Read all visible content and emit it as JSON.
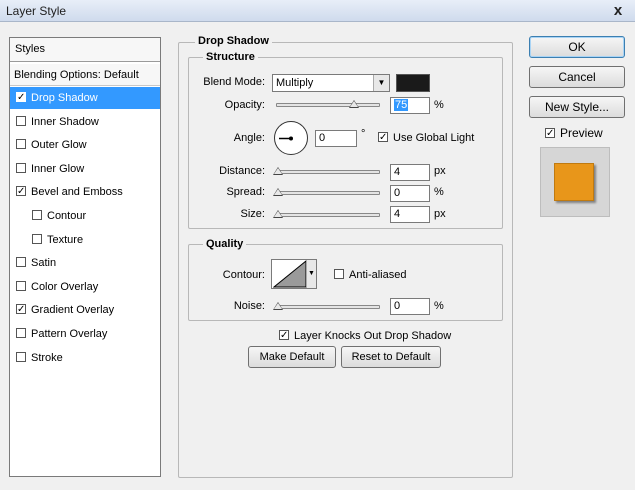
{
  "window": {
    "title": "Layer Style",
    "close_glyph": "x"
  },
  "styles_panel": {
    "header": "Styles",
    "blending": "Blending Options: Default",
    "items": [
      {
        "label": "Drop Shadow",
        "checked": true,
        "selected": true,
        "sub": false
      },
      {
        "label": "Inner Shadow",
        "checked": false,
        "selected": false,
        "sub": false
      },
      {
        "label": "Outer Glow",
        "checked": false,
        "selected": false,
        "sub": false
      },
      {
        "label": "Inner Glow",
        "checked": false,
        "selected": false,
        "sub": false
      },
      {
        "label": "Bevel and Emboss",
        "checked": true,
        "selected": false,
        "sub": false
      },
      {
        "label": "Contour",
        "checked": false,
        "selected": false,
        "sub": true
      },
      {
        "label": "Texture",
        "checked": false,
        "selected": false,
        "sub": true
      },
      {
        "label": "Satin",
        "checked": false,
        "selected": false,
        "sub": false
      },
      {
        "label": "Color Overlay",
        "checked": false,
        "selected": false,
        "sub": false
      },
      {
        "label": "Gradient Overlay",
        "checked": true,
        "selected": false,
        "sub": false
      },
      {
        "label": "Pattern Overlay",
        "checked": false,
        "selected": false,
        "sub": false
      },
      {
        "label": "Stroke",
        "checked": false,
        "selected": false,
        "sub": false
      }
    ]
  },
  "drop_shadow": {
    "title": "Drop Shadow",
    "structure": {
      "title": "Structure",
      "blend_mode_label": "Blend Mode:",
      "blend_mode_value": "Multiply",
      "shadow_color": "#1a1a1a",
      "opacity_label": "Opacity:",
      "opacity_value": "75",
      "opacity_unit": "%",
      "opacity_fraction": 0.75,
      "angle_label": "Angle:",
      "angle_value": "0",
      "angle_unit": "°",
      "use_global_light_label": "Use Global Light",
      "use_global_light": true,
      "distance_label": "Distance:",
      "distance_value": "4",
      "distance_unit": "px",
      "spread_label": "Spread:",
      "spread_value": "0",
      "spread_unit": "%",
      "size_label": "Size:",
      "size_value": "4",
      "size_unit": "px"
    },
    "quality": {
      "title": "Quality",
      "contour_label": "Contour:",
      "anti_aliased_label": "Anti-aliased",
      "anti_aliased": false,
      "noise_label": "Noise:",
      "noise_value": "0",
      "noise_unit": "%"
    },
    "knockout_label": "Layer Knocks Out Drop Shadow",
    "knockout": true,
    "make_default_label": "Make Default",
    "reset_default_label": "Reset to Default"
  },
  "actions": {
    "ok_label": "OK",
    "cancel_label": "Cancel",
    "new_style_label": "New Style...",
    "preview_label": "Preview",
    "preview_checked": true,
    "preview_color": "#e8961a"
  }
}
